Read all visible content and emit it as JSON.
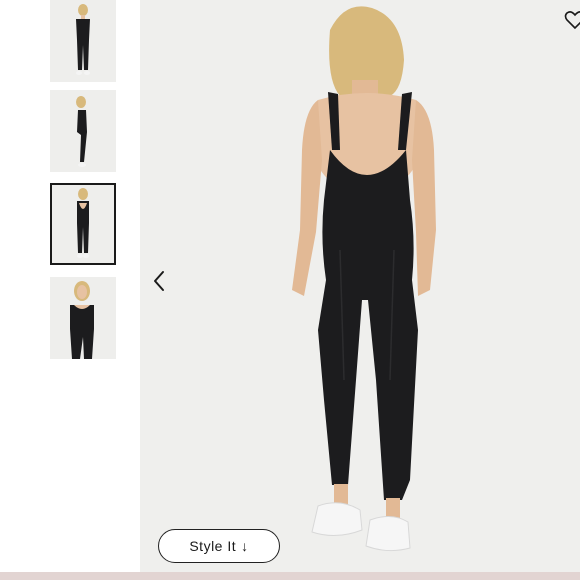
{
  "gallery": {
    "thumbnails": [
      {
        "view": "front"
      },
      {
        "view": "side"
      },
      {
        "view": "back",
        "selected": true
      },
      {
        "view": "front-closeup"
      }
    ],
    "prev_icon": "chevron-left-icon",
    "favorite_icon": "heart-icon",
    "style_button_label": "Style It",
    "style_button_arrow": "↓"
  },
  "colors": {
    "garment": "#1c1c1e",
    "background": "#efefed",
    "skin": "#e7c2a2",
    "hair": "#d8b97c",
    "accent_strip": "#e2d4d2"
  }
}
